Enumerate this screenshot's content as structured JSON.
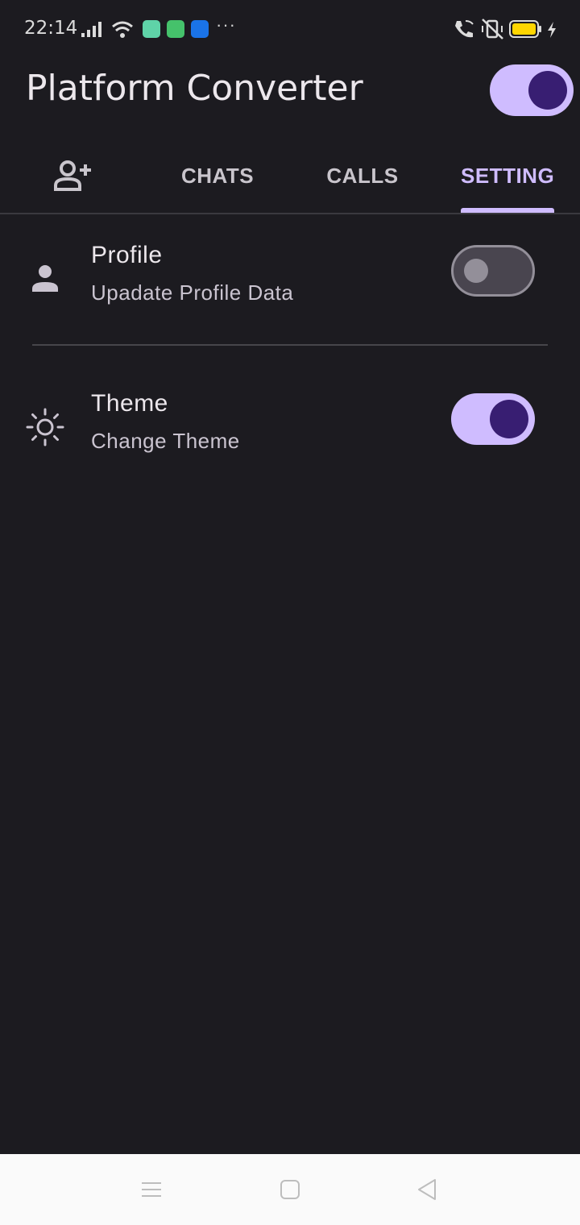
{
  "status_bar": {
    "time": "22:14",
    "icons": [
      "signal-icon",
      "wifi-icon",
      "app-notification-icon",
      "message-notification-icon",
      "usb-notification-icon",
      "more-notifications-icon",
      "wifi-calling-icon",
      "vibrate-off-icon",
      "battery-icon",
      "charging-icon"
    ],
    "battery_color": "#ffd600"
  },
  "app_bar": {
    "title": "Platform Converter",
    "theme_toggle_on": true
  },
  "tabs": [
    {
      "label": "",
      "icon": "add-person-icon",
      "active": false
    },
    {
      "label": "CHATS",
      "active": false
    },
    {
      "label": "CALLS",
      "active": false
    },
    {
      "label": "SETTING",
      "active": true
    }
  ],
  "settings": [
    {
      "title": "Profile",
      "subtitle": "Upadate Profile Data",
      "icon": "person-icon",
      "enabled": false
    },
    {
      "title": "Theme",
      "subtitle": "Change Theme",
      "icon": "sun-icon",
      "enabled": true
    }
  ],
  "colors": {
    "background": "#1c1b20",
    "accent": "#cfbcff",
    "knob_dark": "#381e72"
  },
  "nav_bar": {
    "buttons": [
      "menu-icon",
      "home-icon",
      "back-icon"
    ]
  }
}
